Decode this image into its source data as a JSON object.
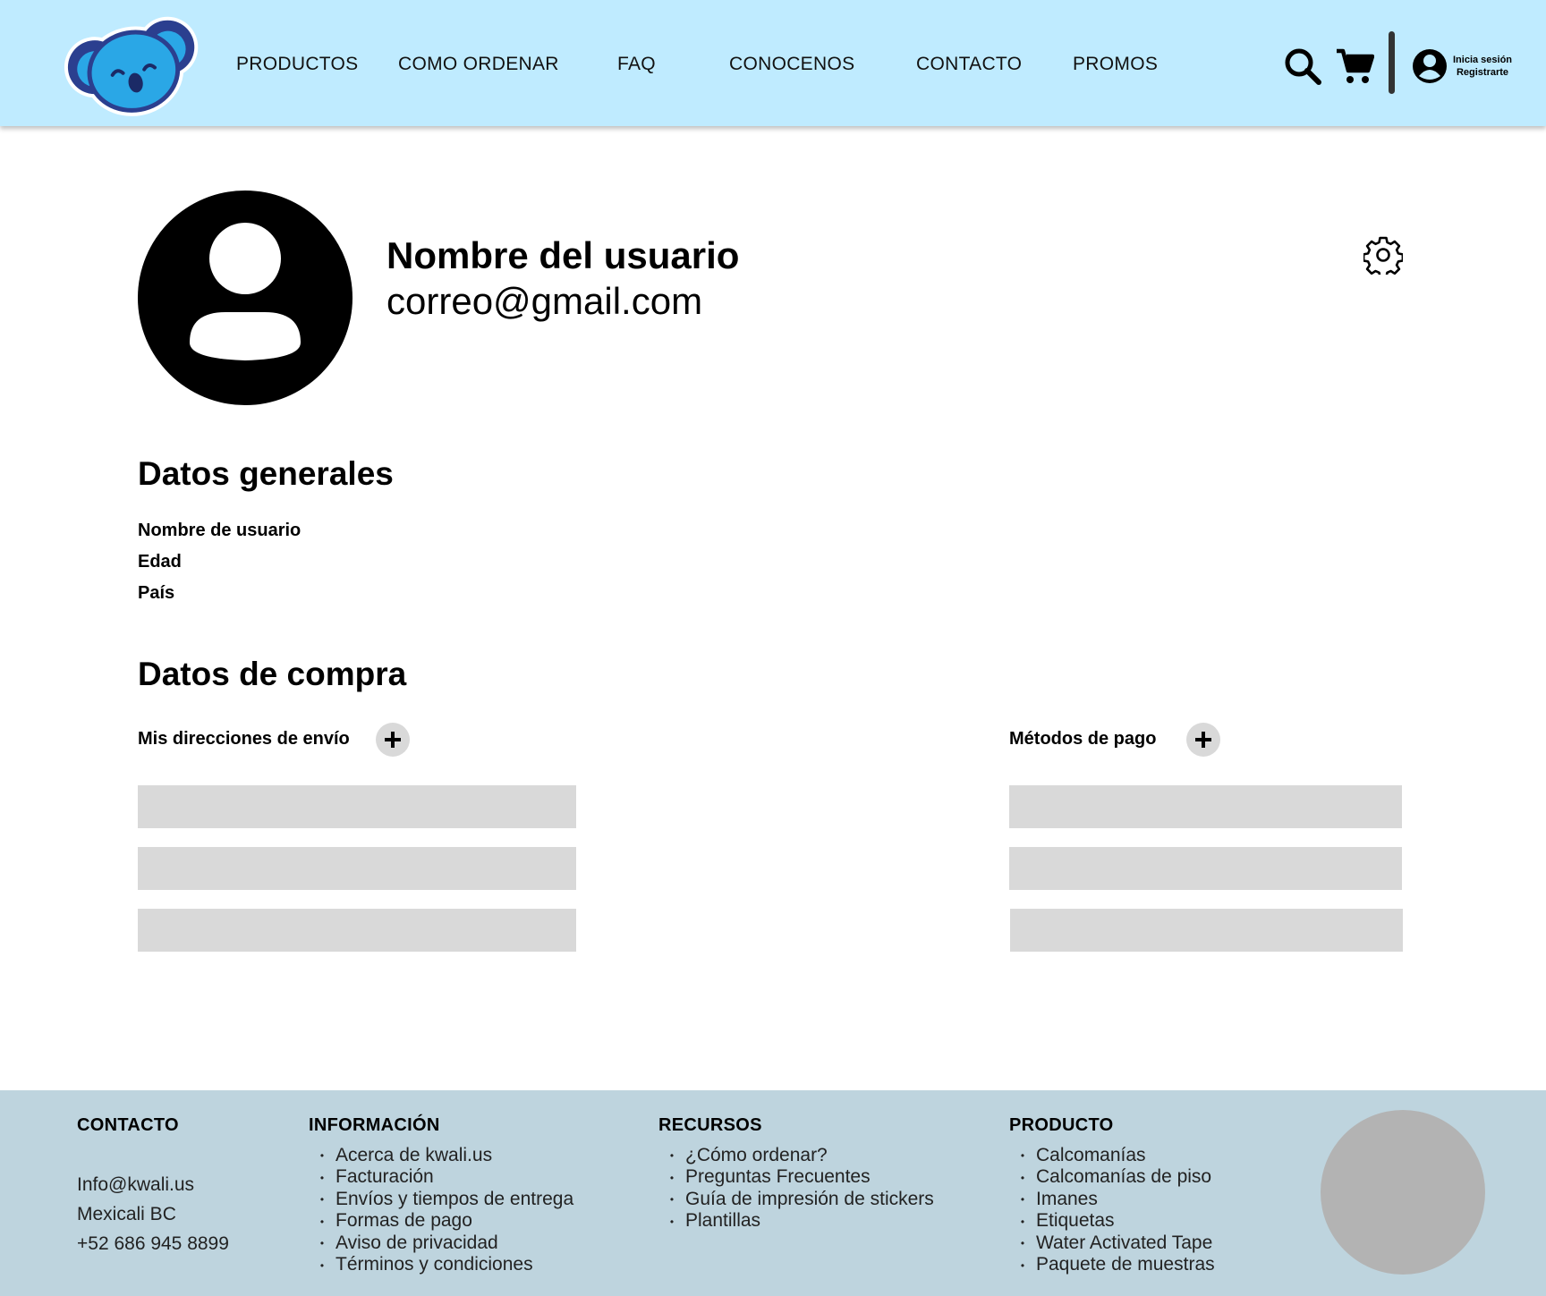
{
  "header": {
    "logo_name": "koala-logo",
    "nav": [
      "PRODUCTOS",
      "COMO ORDENAR",
      "FAQ",
      "CONOCENOS",
      "CONTACTO",
      "PROMOS"
    ],
    "search_icon": "search-icon",
    "cart_icon": "cart-icon",
    "user_icon": "user-circle-icon",
    "login_label": "Inicia sesión",
    "register_label": "Registrarte",
    "bg_color": "#bfebff"
  },
  "profile": {
    "name": "Nombre del usuario",
    "email": "correo@gmail.com",
    "settings_icon": "gear-icon"
  },
  "general": {
    "title": "Datos generales",
    "fields": [
      "Nombre de usuario",
      "Edad",
      "País"
    ]
  },
  "purchase": {
    "title": "Datos de compra",
    "addresses_label": "Mis direcciones de envío",
    "payment_label": "Métodos de pago",
    "placeholder_color": "#d9d9d9"
  },
  "footer": {
    "contact": {
      "title": "CONTACTO",
      "email": "Info@kwali.us",
      "city": "Mexicali BC",
      "phone": "+52 686 945 8899"
    },
    "info": {
      "title": "INFORMACIÓN",
      "items": [
        "Acerca de kwali.us",
        "Facturación",
        "Envíos y tiempos de entrega",
        "Formas de pago",
        "Aviso de privacidad",
        "Términos y condiciones"
      ]
    },
    "resources": {
      "title": "RECURSOS",
      "items": [
        "¿Cómo ordenar?",
        "Preguntas Frecuentes",
        "Guía de impresión de stickers",
        "Plantillas"
      ]
    },
    "product": {
      "title": "PRODUCTO",
      "items": [
        "Calcomanías",
        "Calcomanías de piso",
        "Imanes",
        "Etiquetas",
        "Water Activated Tape",
        "Paquete de muestras"
      ]
    },
    "bg_color": "#bed4de"
  }
}
